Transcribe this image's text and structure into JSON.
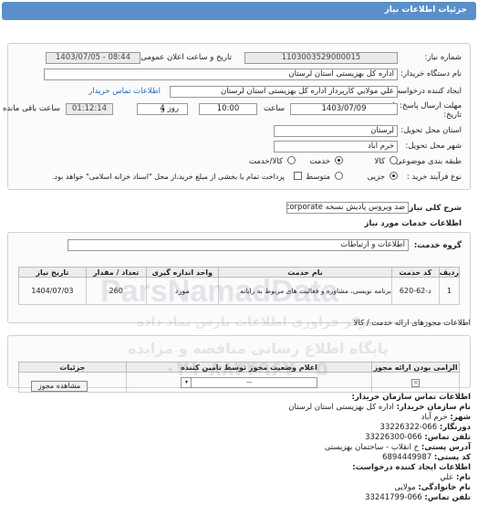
{
  "header": {
    "title": "جزئیات اطلاعات نیاز"
  },
  "form": {
    "need_number_label": "شماره نیاز:",
    "need_number": "1103003529000015",
    "announce_label": "تاریخ و ساعت اعلان عمومی:",
    "announce_value": "1403/07/05 - 08:44",
    "buyer_label": "نام دستگاه خریدار:",
    "buyer_value": "اداره کل بهزیستی استان لرستان",
    "creator_label": "ایجاد کننده درخواست:",
    "creator_value": "علي مولايي کارپرداز اداره کل بهزیستی استان لرستان",
    "buyer_contact_link": "اطلاعات تماس خریدار",
    "deadline_label": "مهلت ارسال پاسخ: تا",
    "deadline_label2": "تاریخ:",
    "deadline_date": "1403/07/09",
    "time_label": "ساعت",
    "deadline_time": "10:00",
    "days_count": "4",
    "days_label": "روز و",
    "remaining_time": "01:12:14",
    "remaining_label": "ساعت باقی مانده",
    "delivery_province_label": "استان محل تحویل:",
    "delivery_province": "لرستان",
    "delivery_city_label": "شهر محل تحویل:",
    "delivery_city": "خرم آباد",
    "category_label": "طبقه بندی موضوعی:",
    "category_options": [
      "کالا",
      "خدمت",
      "کالا/خدمت"
    ],
    "category_selected": "خدمت",
    "purchase_type_label": "نوع فرآیند خرید :",
    "purchase_options": [
      "جزیی",
      "متوسط"
    ],
    "purchase_selected": "جزیی",
    "payment_note": "پرداخت تمام یا بخشی از مبلغ خرید،از محل \"اسناد خزانه اسلامی\" خواهد بود."
  },
  "summary": {
    "label": "شرح کلی نیاز:",
    "value": "ضد ویروس پادیش نسخه corporate",
    "services_heading": "اطلاعات خدمات مورد نیاز",
    "group_label": "گروه خدمت:",
    "group_value": "اطلاعات و ارتباطات"
  },
  "services_table": {
    "headers": [
      "ردیف",
      "کد خدمت",
      "نام خدمت",
      "واحد اندازه گیری",
      "تعداد / مقدار",
      "تاریخ نیاز"
    ],
    "rows": [
      [
        "1",
        "د-62-620",
        "برنامه نویسی، مشاوره و فعالیت های مربوط به رایانه",
        "مورد",
        "260",
        "1404/07/03"
      ]
    ]
  },
  "permits": {
    "heading": "اطلاعات مجوزهای ارائه خدمت / کالا",
    "headers": [
      "الزامی بودن ارائه مجوز",
      "اعلام وضعیت مجوز توسط تامین کننده",
      "جزئیات"
    ],
    "status_value": "--",
    "view_button": "مشاهده مجوز"
  },
  "contact": {
    "heading": "اطلاعات تماس سازمان خریدار:",
    "lines": [
      [
        "نام سازمان خریدار:",
        "اداره کل بهزیستی استان لرستان"
      ],
      [
        "شهر:",
        "خرم آباد"
      ],
      [
        "دورنگار:",
        "066-33226322"
      ],
      [
        "تلفن تماس:",
        "066-33226300"
      ],
      [
        "آدرس پستی:",
        "خ انقلاب - ساختمان بهزیستی"
      ],
      [
        "کد پستی:",
        "6894449987"
      ]
    ],
    "creator_heading": "اطلاعات ایجاد کننده درخواست:",
    "creator_lines": [
      [
        "نام:",
        "علي"
      ],
      [
        "نام خانوادگی:",
        "مولایی"
      ],
      [
        "تلفن تماس:",
        "066-33241799"
      ]
    ]
  },
  "watermark": {
    "line1": "ParsNamadData",
    "line2": "مرکز فراوری اطلاعات پارس نماد داده",
    "line3": "پایگاه اطلاع رسانی مناقصه و مزایده",
    "line4": "۰۲۱-۸۸۳۴۹۶۷۰-۵"
  }
}
